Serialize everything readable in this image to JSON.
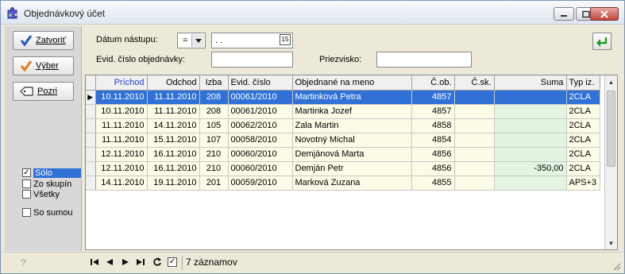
{
  "window": {
    "title": "Objednávkový účet",
    "icon": "puzzle-icon"
  },
  "sidebar": {
    "buttons": [
      {
        "label": "Zatvoriť",
        "icon": "check-icon",
        "color": "#1f57c8"
      },
      {
        "label": "Výber",
        "icon": "check-icon",
        "color": "#e37b1a"
      },
      {
        "label": "Pozri",
        "icon": "tag-icon"
      }
    ],
    "options": [
      {
        "label": "Sólo",
        "checked": true,
        "selected": true
      },
      {
        "label": "Zo skupín",
        "checked": false
      },
      {
        "label": "Všetky",
        "checked": false
      }
    ],
    "so_sumou": {
      "label": "So sumou",
      "checked": false
    }
  },
  "filters": {
    "datum_label": "Dátum nástupu:",
    "operator": "=",
    "datum_value": ". .",
    "evid_label": "Evid. číslo objednávky:",
    "evid_value": "",
    "priezvisko_label": "Priezvisko:",
    "priezvisko_value": ""
  },
  "table": {
    "columns": [
      "Príchod",
      "Odchod",
      "Izba",
      "Evid. číslo",
      "Objednané na meno",
      "Č.ob.",
      "Č.sk.",
      "Suma",
      "Typ iz."
    ],
    "rows": [
      [
        "10.11.2010",
        "11.11.2010",
        "208",
        "00061/2010",
        "Martinková Petra",
        "4857",
        "",
        "",
        "2CLA"
      ],
      [
        "10.11.2010",
        "11.11.2010",
        "208",
        "00061/2010",
        "Martinka Jozef",
        "4857",
        "",
        "",
        "2CLA"
      ],
      [
        "11.11.2010",
        "14.11.2010",
        "105",
        "00062/2010",
        "Zala Martin",
        "4858",
        "",
        "",
        "2CLA"
      ],
      [
        "11.11.2010",
        "15.11.2010",
        "107",
        "00058/2010",
        "Novotný Michal",
        "4854",
        "",
        "",
        "2CLA"
      ],
      [
        "12.11.2010",
        "16.11.2010",
        "210",
        "00060/2010",
        "Demjánová Marta",
        "4856",
        "",
        "",
        "2CLA"
      ],
      [
        "12.11.2010",
        "16.11.2010",
        "210",
        "00060/2010",
        "Demján Petr",
        "4856",
        "",
        "-350,00",
        "2CLA"
      ],
      [
        "14.11.2010",
        "19.11.2010",
        "201",
        "00059/2010",
        "Marková Zuzana",
        "4855",
        "",
        "",
        "APS+3"
      ]
    ],
    "selected_row": 0
  },
  "status": {
    "help": "?",
    "record_count": "7 záznamov"
  },
  "colors": {
    "selection": "#2f71d6",
    "row_bg": "#fbfbe6",
    "suma_bg": "#e3f5e1",
    "header_sort": "#1f3fcf"
  }
}
